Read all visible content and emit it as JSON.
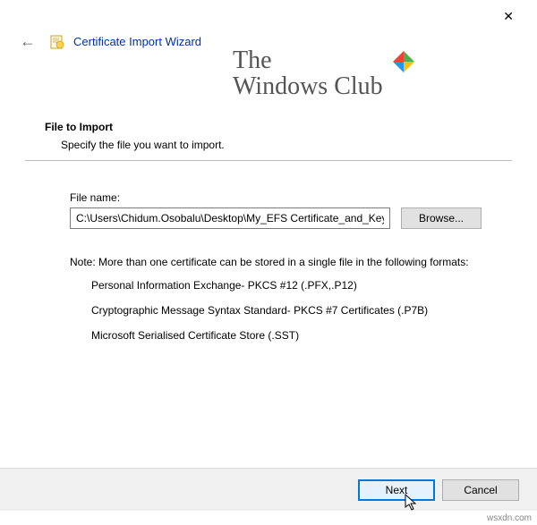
{
  "window": {
    "title": "Certificate Import Wizard"
  },
  "watermark": {
    "line1": "The",
    "line2": "Windows Club"
  },
  "section": {
    "title": "File to Import",
    "desc": "Specify the file you want to import."
  },
  "file": {
    "label": "File name:",
    "value": "C:\\Users\\Chidum.Osobalu\\Desktop\\My_EFS Certificate_and_Key.p",
    "browse": "Browse..."
  },
  "note": {
    "intro": "Note:  More than one certificate can be stored in a single file in the following formats:",
    "items": [
      "Personal Information Exchange- PKCS #12 (.PFX,.P12)",
      "Cryptographic Message Syntax Standard- PKCS #7 Certificates (.P7B)",
      "Microsoft Serialised Certificate Store (.SST)"
    ]
  },
  "footer": {
    "next": "Next",
    "cancel": "Cancel"
  },
  "attribution": "wsxdn.com"
}
